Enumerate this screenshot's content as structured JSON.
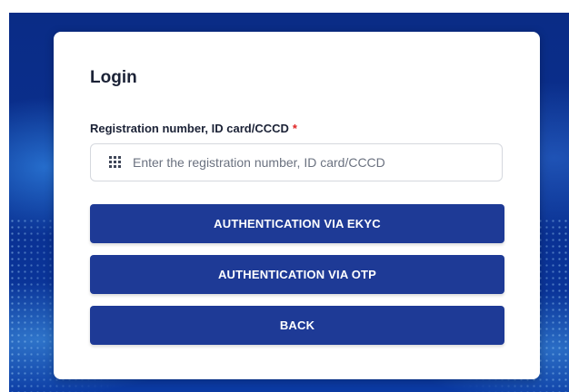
{
  "login": {
    "title": "Login",
    "field_label": "Registration number, ID card/CCCD",
    "required_mark": "*",
    "input_placeholder": "Enter the registration number, ID card/CCCD",
    "input_value": "",
    "buttons": {
      "ekyc": "AUTHENTICATION VIA EKYC",
      "otp": "AUTHENTICATION VIA OTP",
      "back": "BACK"
    }
  },
  "colors": {
    "primary_button": "#1e3a96",
    "background_blue": "#0a2f8f",
    "required": "#e02424"
  },
  "icons": {
    "input_prefix": "grid-icon"
  }
}
